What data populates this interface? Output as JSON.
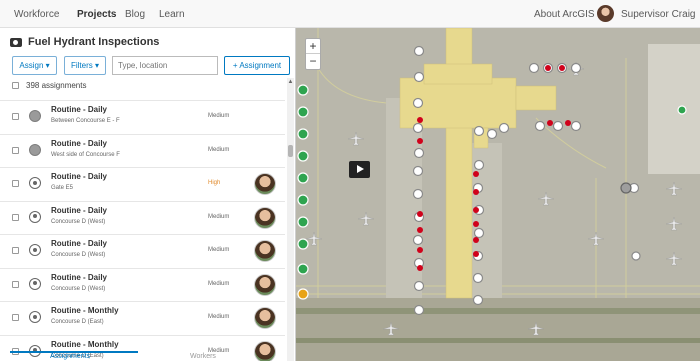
{
  "nav": {
    "items": [
      "Workforce",
      "Projects",
      "Blog",
      "Learn"
    ],
    "about": "About ArcGIS",
    "user": "Supervisor Craig"
  },
  "project": {
    "title": "Fuel Hydrant Inspections",
    "assign_label": "Assign ▾",
    "filters_label": "Filters ▾",
    "search_placeholder": "Type, location",
    "new_assignment_label": "+ Assignment",
    "count_text": "398 assignments"
  },
  "assignments": [
    {
      "title": "Routine - Daily",
      "location": "Between Concourse E - F",
      "priority": "Medium",
      "status": "unassigned",
      "has_worker": false
    },
    {
      "title": "Routine - Daily",
      "location": "West side of Concourse F",
      "priority": "Medium",
      "status": "unassigned",
      "has_worker": false
    },
    {
      "title": "Routine - Daily",
      "location": "Gate E5",
      "priority": "High",
      "status": "assigned",
      "has_worker": true
    },
    {
      "title": "Routine - Daily",
      "location": "Concourse D (West)",
      "priority": "Medium",
      "status": "assigned",
      "has_worker": true
    },
    {
      "title": "Routine - Daily",
      "location": "Concourse D (West)",
      "priority": "Medium",
      "status": "assigned",
      "has_worker": true
    },
    {
      "title": "Routine - Daily",
      "location": "Concourse D (West)",
      "priority": "Medium",
      "status": "assigned",
      "has_worker": true
    },
    {
      "title": "Routine - Monthly",
      "location": "Concourse D (East)",
      "priority": "Medium",
      "status": "assigned",
      "has_worker": true
    },
    {
      "title": "Routine - Monthly",
      "location": "Concourse D (East)",
      "priority": "Medium",
      "status": "assigned",
      "has_worker": true
    }
  ],
  "tabs": {
    "assignments": "Assignments",
    "workers": "Workers"
  },
  "map": {
    "zoom_in": "+",
    "zoom_out": "−",
    "colors": {
      "terminal": "#e7d98e",
      "worker_green": "#2ea44f",
      "worker_orange": "#e8a317",
      "assigned_red": "#d0021b",
      "marker_gray": "#9e9e9e"
    }
  },
  "icons": {
    "project": "folder-icon",
    "zoom_in": "plus-icon",
    "zoom_out": "minus-icon",
    "play": "play-icon"
  }
}
